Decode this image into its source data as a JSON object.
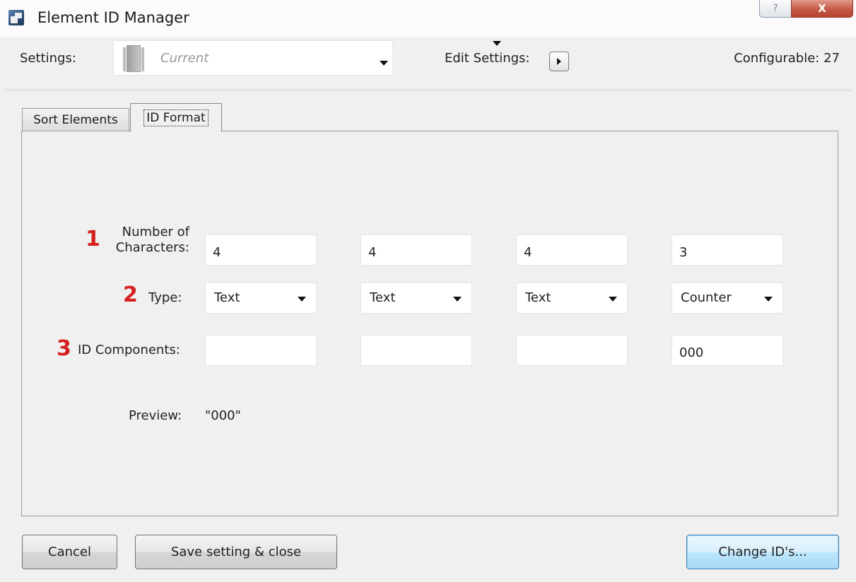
{
  "window": {
    "title": "Element ID Manager",
    "help_glyph": "?",
    "close_glyph": "X"
  },
  "header": {
    "settings_label": "Settings:",
    "settings_value": "Current",
    "edit_settings_label": "Edit Settings:",
    "configurable_label": "Configurable: 27"
  },
  "tabs": [
    {
      "label": "Sort Elements",
      "active": false
    },
    {
      "label": "ID Format",
      "active": true
    }
  ],
  "form": {
    "annotations": [
      "1",
      "2",
      "3"
    ],
    "annotation_color": "#d42020",
    "chars_label_line1": "Number of",
    "chars_label_line2": "Characters:",
    "type_label": "Type:",
    "components_label": "ID Components:",
    "columns": [
      {
        "characters": "4",
        "type": "Text",
        "component": ""
      },
      {
        "characters": "4",
        "type": "Text",
        "component": ""
      },
      {
        "characters": "4",
        "type": "Text",
        "component": ""
      },
      {
        "characters": "3",
        "type": "Counter",
        "component": "000"
      }
    ],
    "preview_label": "Preview:",
    "preview_value": "\"000\""
  },
  "buttons": {
    "cancel": "Cancel",
    "save_close": "Save setting & close",
    "change_ids": "Change ID's..."
  },
  "colors": {
    "background": "#f0f0f0",
    "primary_button": "#bee6fd",
    "close_button": "#c45a47"
  }
}
